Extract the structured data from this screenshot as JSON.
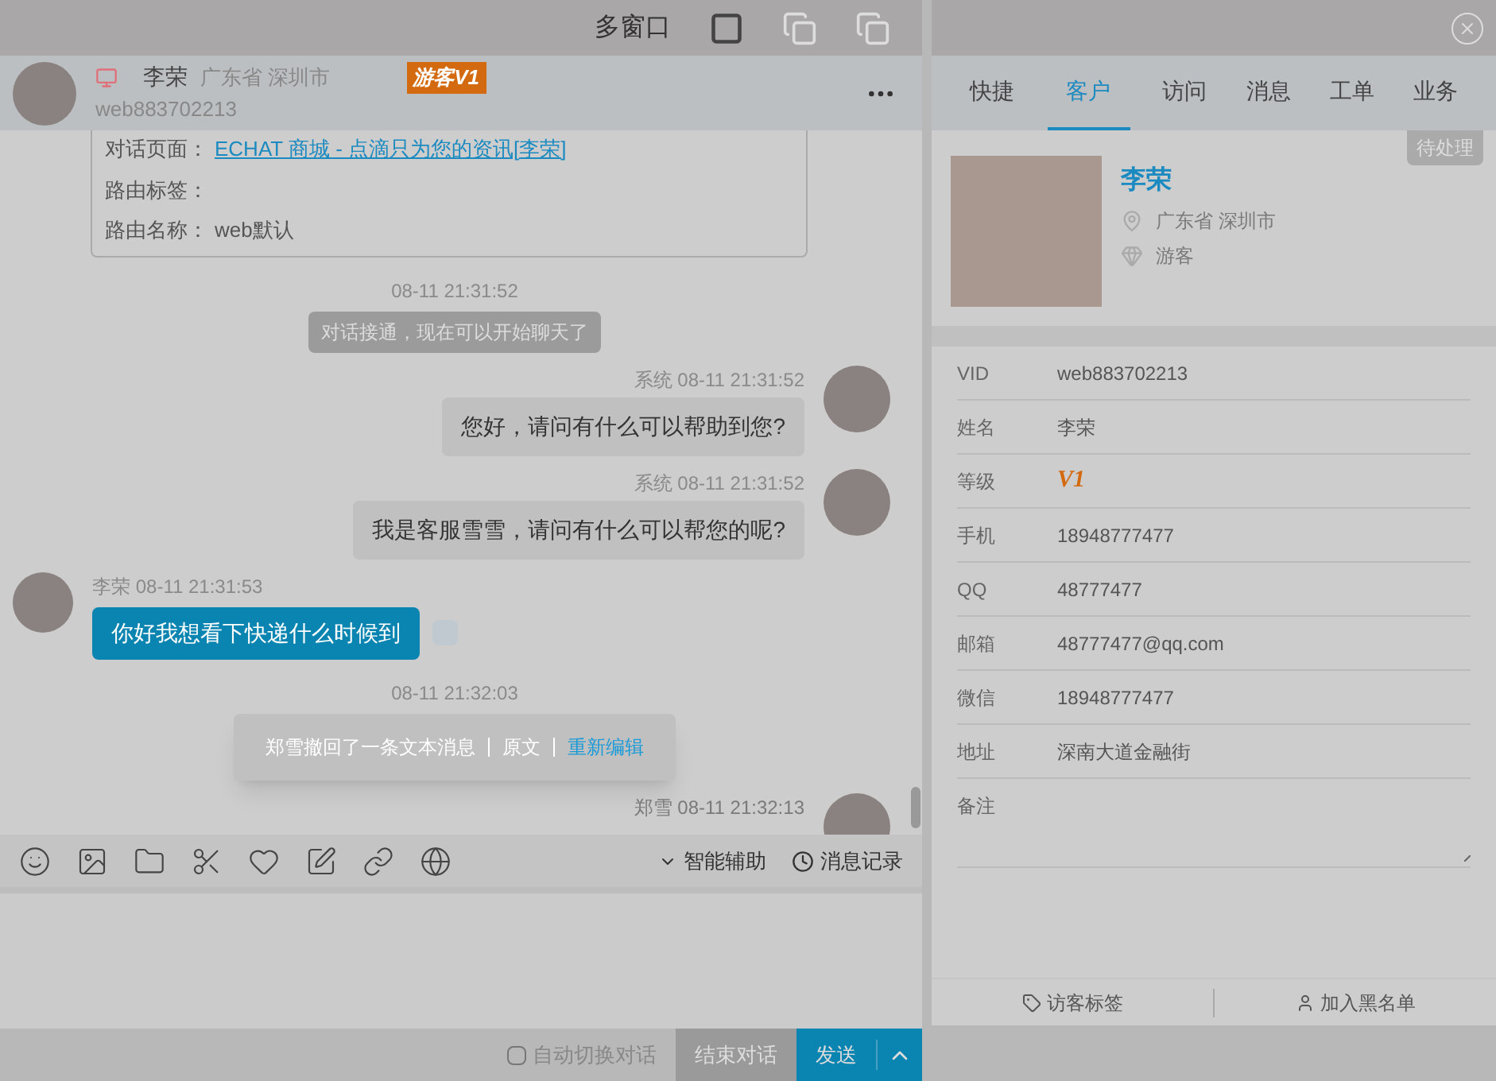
{
  "top_bar": {
    "title": "多窗口"
  },
  "visitor": {
    "name": "李荣",
    "location": "广东省 深圳市",
    "badge": "游客V1",
    "id": "web883702213"
  },
  "route_card": [
    {
      "label": "对话页面：",
      "value": "ECHAT 商城 - 点滴只为您的资讯[李荣]",
      "kind": "link"
    },
    {
      "label": "路由标签：",
      "kind": "text"
    },
    {
      "label": "路由名称：",
      "value": "web默认",
      "kind": "text"
    }
  ],
  "messages": [
    {
      "kind": "system",
      "time": "08-11 21:31:52",
      "text": "对话接通，现在可以开始聊天了"
    },
    {
      "kind": "agent",
      "sender": "系统",
      "time": "08-11 21:31:52",
      "text": "您好，请问有什么可以帮助到您?"
    },
    {
      "kind": "agent",
      "sender": "系统",
      "time": "08-11 21:31:52",
      "text": "我是客服雪雪，请问有什么可以帮您的呢?"
    },
    {
      "kind": "visitor",
      "sender": "李荣",
      "time": "08-11 21:31:53",
      "text": "你好我想看下快递什么时候到"
    },
    {
      "kind": "recall",
      "time": "08-11 21:32:03",
      "text": "郑雪撤回了一条文本消息",
      "original": "原文",
      "edit": "重新编辑"
    },
    {
      "kind": "agent_cut",
      "sender": "郑雪",
      "time": "08-11 21:32:13"
    }
  ],
  "toolbar": {
    "assist": "智能辅助",
    "history": "消息记录"
  },
  "footer": {
    "auto_switch": {
      "label": "自动切换对话",
      "checked": false
    },
    "end": "结束对话",
    "send": "发送"
  },
  "tabs": [
    {
      "label": "快捷",
      "selected": false
    },
    {
      "label": "客户",
      "selected": true
    },
    {
      "label": "访问",
      "selected": false
    },
    {
      "label": "消息",
      "selected": false
    },
    {
      "label": "工单",
      "selected": false
    },
    {
      "label": "业务",
      "selected": false
    }
  ],
  "profile": {
    "status": "待处理",
    "name": "李荣",
    "location": "广东省 深圳市",
    "type": "游客"
  },
  "fields": [
    {
      "label": "VID",
      "value": "web883702213",
      "kind": "text"
    },
    {
      "label": "姓名",
      "value": "李荣",
      "kind": "text"
    },
    {
      "label": "等级",
      "value": "V1",
      "kind": "level"
    },
    {
      "label": "手机",
      "value": "18948777477",
      "kind": "text"
    },
    {
      "label": "QQ",
      "value": "48777477",
      "kind": "text"
    },
    {
      "label": "邮箱",
      "value": "48777477@qq.com",
      "kind": "text"
    },
    {
      "label": "微信",
      "value": "18948777477",
      "kind": "text"
    },
    {
      "label": "地址",
      "value": "深南大道金融街",
      "kind": "text"
    },
    {
      "label": "备注",
      "kind": "note"
    }
  ],
  "actions": {
    "tag": "访客标签",
    "blacklist": "加入黑名单"
  }
}
